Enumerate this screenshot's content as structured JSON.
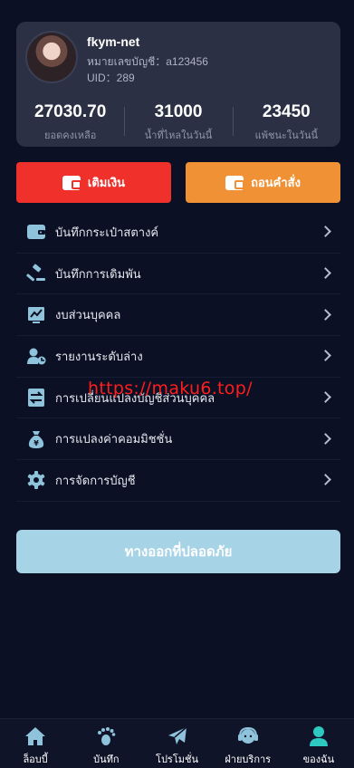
{
  "profile": {
    "username": "fkym-net",
    "account_line": "หมายเลขบัญชี：a123456",
    "uid_line": "UID：289"
  },
  "stats": [
    {
      "value": "27030.70",
      "label": "ยอดคงเหลือ"
    },
    {
      "value": "31000",
      "label": "น้ำที่ไหลในวันนี้"
    },
    {
      "value": "23450",
      "label": "แพ้ชนะในวันนี้"
    }
  ],
  "actions": {
    "deposit_label": "เติมเงิน",
    "withdraw_label": "ถอนคำสั่ง"
  },
  "menu": [
    {
      "label": "บันทึกกระเป๋าสตางค์",
      "icon": "wallet-icon"
    },
    {
      "label": "บันทึกการเดิมพัน",
      "icon": "gavel-icon"
    },
    {
      "label": "งบส่วนบุคคล",
      "icon": "chart-icon"
    },
    {
      "label": "รายงานระดับล่าง",
      "icon": "user-report-icon"
    },
    {
      "label": "การเปลี่ยนแปลงบัญชีส่วนบุคคล",
      "icon": "transfer-icon"
    },
    {
      "label": "การแปลงค่าคอมมิชชั่น",
      "icon": "money-bag-icon"
    },
    {
      "label": "การจัดการบัญชี",
      "icon": "gear-icon"
    }
  ],
  "logout_label": "ทางออกที่ปลอดภัย",
  "watermark": "https://maku6.top/",
  "tabs": [
    {
      "label": "ล็อบบี้",
      "icon": "home-icon"
    },
    {
      "label": "บันทึก",
      "icon": "footprint-icon"
    },
    {
      "label": "โปรโมชั่น",
      "icon": "send-icon"
    },
    {
      "label": "ฝ่ายบริการ",
      "icon": "headset-icon"
    },
    {
      "label": "ของฉัน",
      "icon": "person-icon"
    }
  ],
  "colors": {
    "background": "#0b1024",
    "card": "#2b3044",
    "deposit": "#f0302b",
    "withdraw": "#ef9134",
    "logout": "#a6d3e6",
    "icon_blue": "#8fc3dc",
    "active_tab": "#2ec9c1"
  }
}
